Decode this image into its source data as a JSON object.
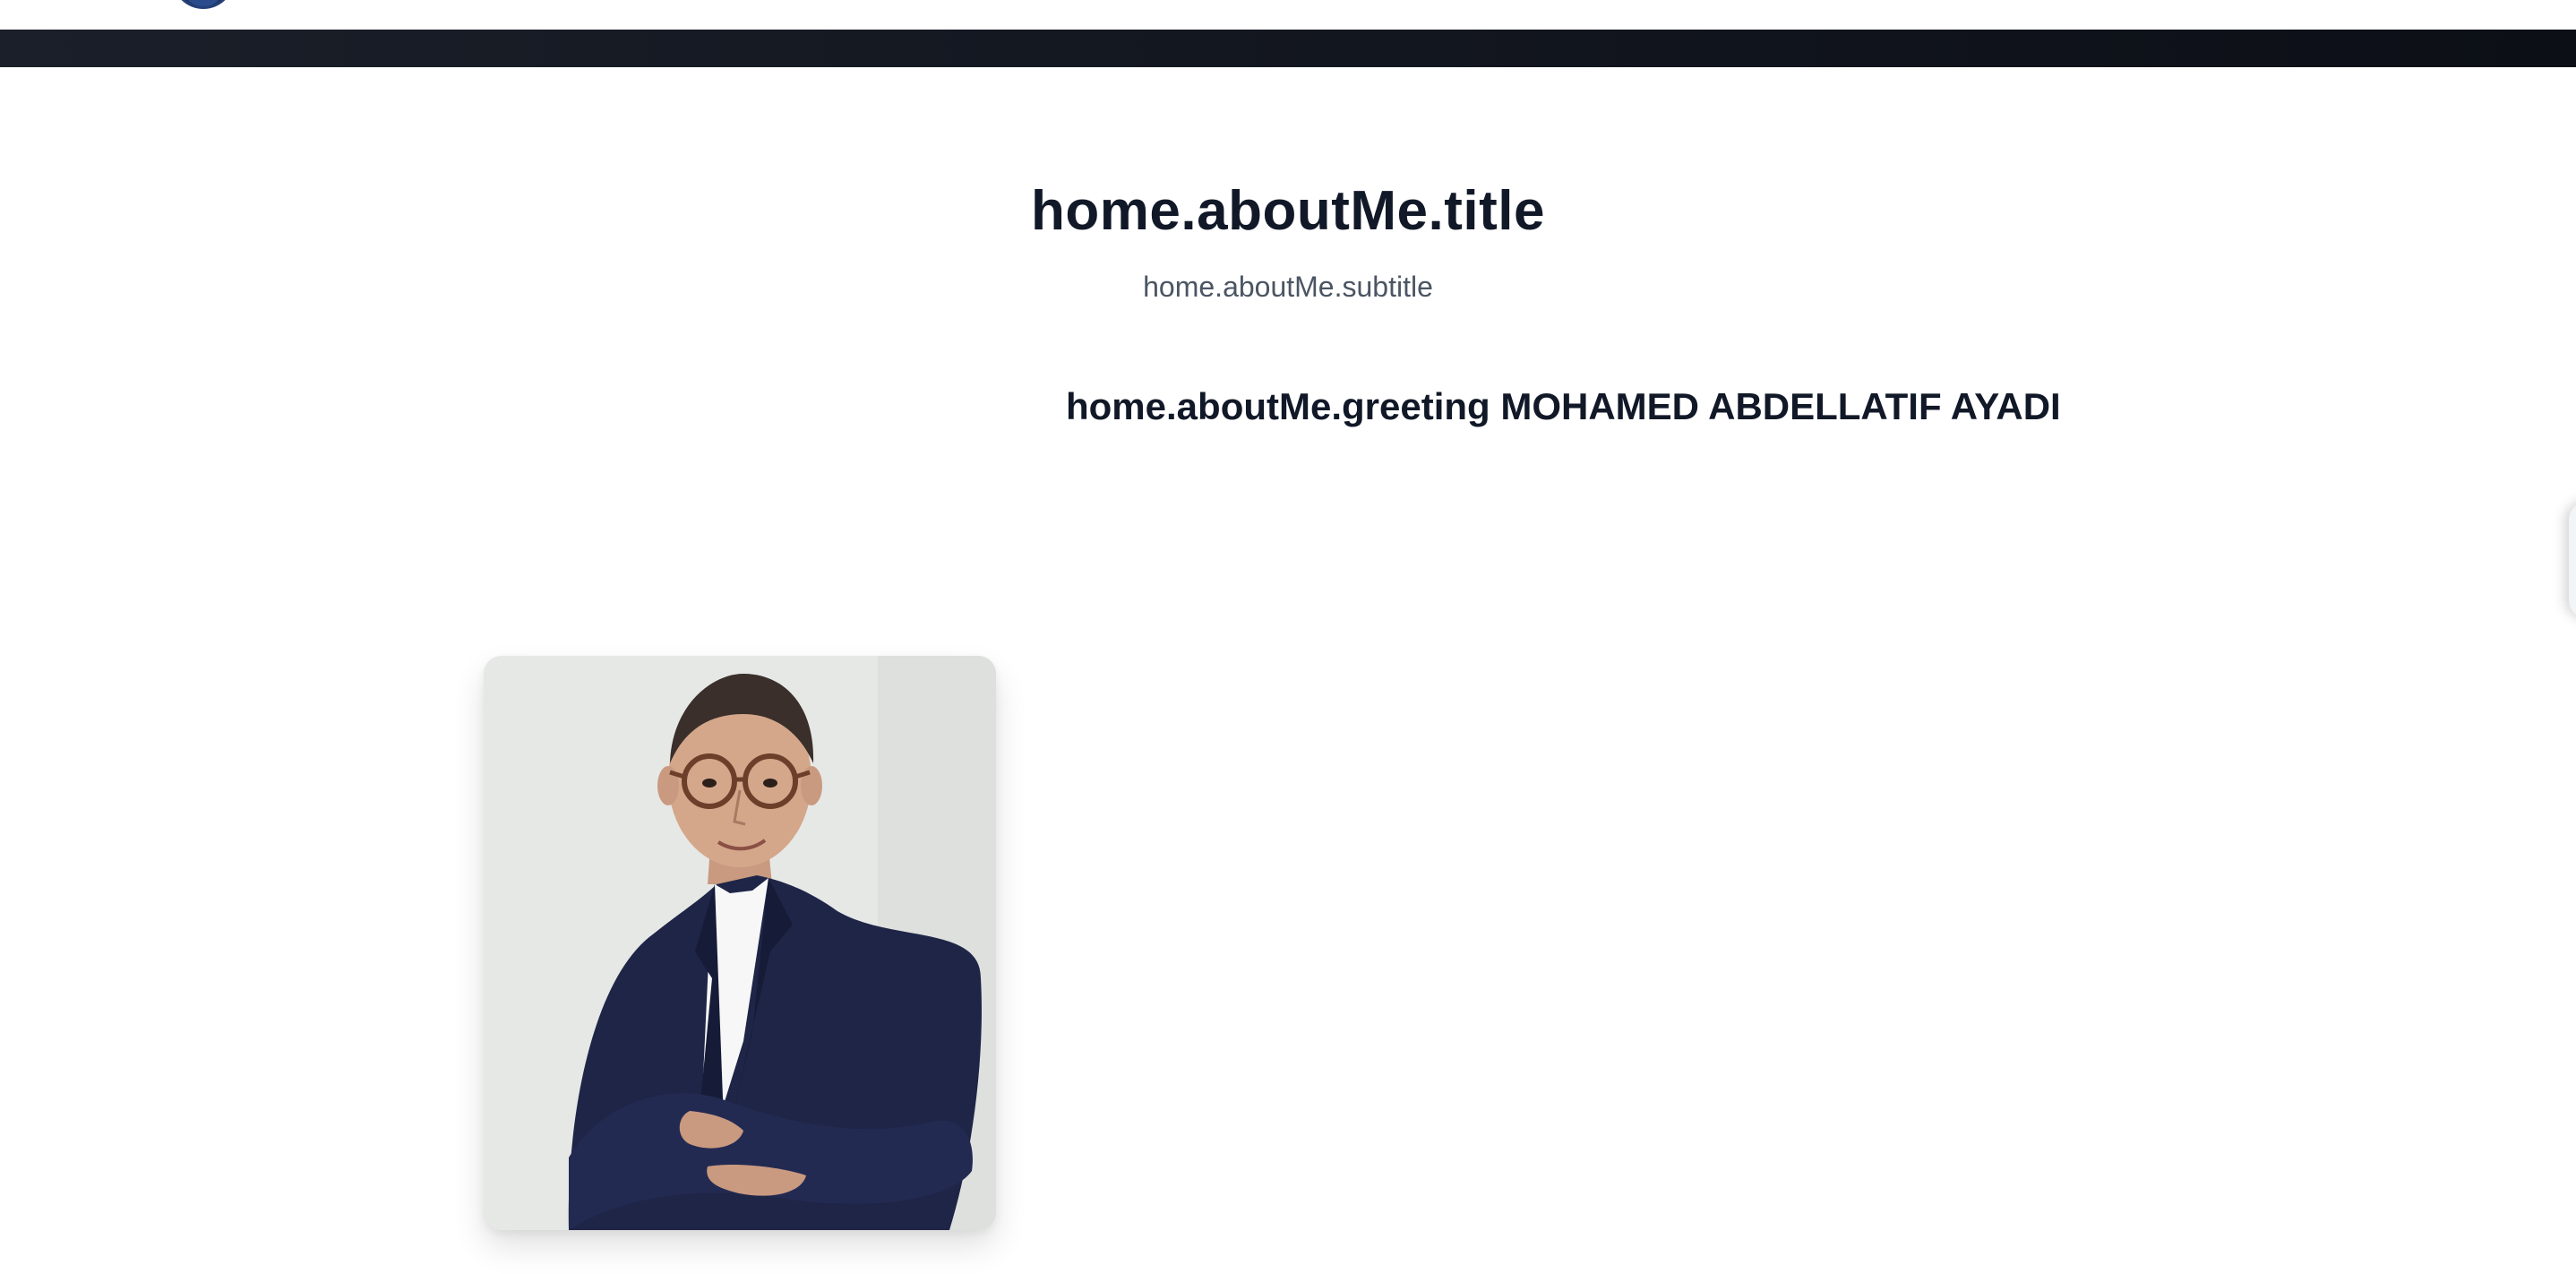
{
  "header": {
    "logo_icon": "profile-logo-icon"
  },
  "about": {
    "title": "home.aboutMe.title",
    "subtitle": "home.aboutMe.subtitle",
    "greeting": "home.aboutMe.greeting MOHAMED ABDELLATIF AYADI"
  },
  "portrait": {
    "icon": "portrait-photo",
    "alt": "Portrait of Mohamed Abdellatif Ayadi"
  },
  "colors": {
    "heading": "#111827",
    "subtitle": "#4b5563",
    "band": "#141821",
    "suit": "#1f2547"
  }
}
